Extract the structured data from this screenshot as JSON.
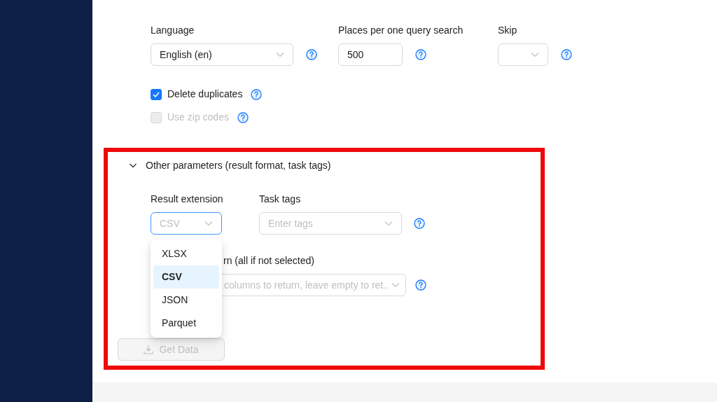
{
  "fields": [
    {
      "label": "Language",
      "kind": "select",
      "value": "English (en)"
    },
    {
      "label": "Places per one query search",
      "kind": "input",
      "value": "500"
    },
    {
      "label": "Skip",
      "kind": "select"
    }
  ],
  "checkboxes": [
    {
      "label": "Delete duplicates",
      "checked": true,
      "disabled": false
    },
    {
      "label": "Use zip codes",
      "checked": false,
      "disabled": true
    }
  ],
  "other_parameters": {
    "title": "Other parameters (result format, task tags)",
    "expanded": true,
    "result_extension": {
      "label": "Result extension",
      "value": "CSV",
      "open": true,
      "options": [
        {
          "label": "XLSX",
          "selected": false
        },
        {
          "label": "CSV",
          "selected": true
        },
        {
          "label": "JSON",
          "selected": false
        },
        {
          "label": "Parquet",
          "selected": false
        }
      ]
    },
    "task_tags": {
      "label": "Task tags",
      "placeholder": "Enter tags"
    },
    "columns": {
      "label": "rn (all if not selected)",
      "placeholder": "columns to return, leave empty to ret.."
    }
  },
  "get_data_button": {
    "label": "Get Data",
    "disabled": true
  }
}
